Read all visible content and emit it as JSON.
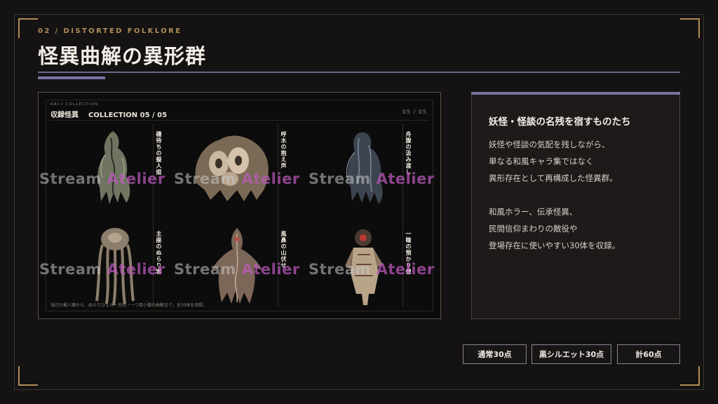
{
  "header": {
    "kicker": "02 / DISTORTED FOLKLORE",
    "title": "怪異曲解の異形群"
  },
  "gallery": {
    "small_label": "KAI-I COLLECTION",
    "heading": "収録怪異",
    "subheading": "COLLECTION 05 / 05",
    "page": "05 / 05",
    "footer": "海辺の擬人魔から、ぬらりひょん・天狗・一つ目小僧の曲解まで。全30体を収録。",
    "items": [
      {
        "label": "磯待ちの擬人姫"
      },
      {
        "label": "呼水の抱え声"
      },
      {
        "label": "舟腹の汲み渡し"
      },
      {
        "label": "主座のぬらり客"
      },
      {
        "label": "風鼻の山伏せ"
      },
      {
        "label": "一瞳の預かり僧"
      }
    ],
    "watermark": {
      "part1": "Stream",
      "part2": "Atelier"
    }
  },
  "card": {
    "heading": "妖怪・怪談の名残を宿すものたち",
    "para1": [
      "妖怪や怪談の気配を残しながら、",
      "単なる和風キャラ集ではなく",
      "異形存在として再構成した怪異群。"
    ],
    "para2": [
      "和風ホラー、伝承怪異、",
      "民間信仰まわりの敵役や",
      "登場存在に使いやすい30体を収録。"
    ]
  },
  "tags": [
    "通常30点",
    "黒シルエット30点",
    "計60点"
  ],
  "colors": {
    "accent_gold": "#b08d57",
    "accent_violet": "#7a719e",
    "watermark_pink": "#be5abe"
  }
}
